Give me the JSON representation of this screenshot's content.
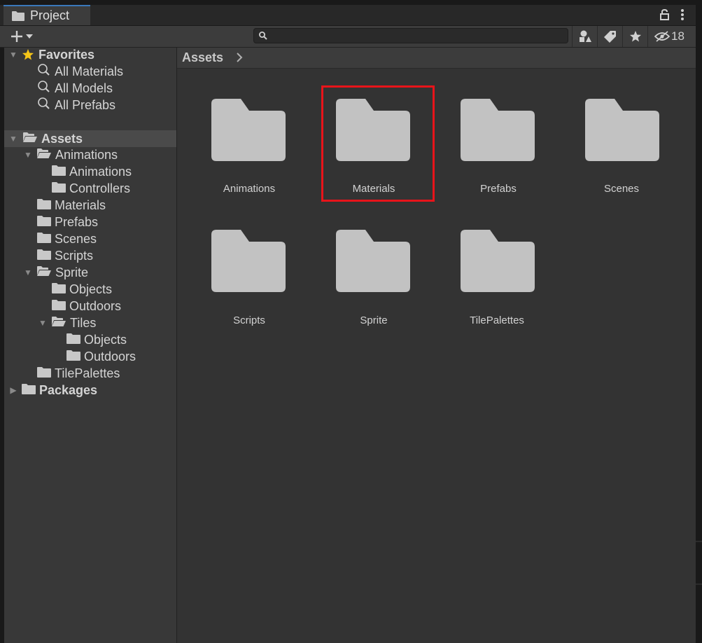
{
  "window": {
    "tab_label": "Project",
    "hidden_count": "18",
    "search": {
      "value": "",
      "placeholder": ""
    }
  },
  "breadcrumb": {
    "label": "Assets"
  },
  "tree": {
    "favorites": {
      "label": "Favorites",
      "items": [
        "All Materials",
        "All Models",
        "All Prefabs"
      ]
    },
    "assets": {
      "label": "Assets",
      "animations": {
        "label": "Animations",
        "children": [
          "Animations",
          "Controllers"
        ]
      },
      "materials": "Materials",
      "prefabs": "Prefabs",
      "scenes": "Scenes",
      "scripts": "Scripts",
      "sprite": {
        "label": "Sprite",
        "objects": "Objects",
        "outdoors": "Outdoors",
        "tiles": {
          "label": "Tiles",
          "children": [
            "Objects",
            "Outdoors"
          ]
        }
      },
      "tilepalettes": "TilePalettes"
    },
    "packages": {
      "label": "Packages"
    }
  },
  "grid": {
    "folders": [
      "Animations",
      "Materials",
      "Prefabs",
      "Scenes",
      "Scripts",
      "Sprite",
      "TilePalettes"
    ],
    "highlighted": "Materials"
  },
  "icons": {
    "tab": "folder-icon",
    "add": "plus-icon",
    "dropdown": "chevron-down-icon",
    "lock": "lock-icon",
    "menu": "kebab-menu-icon",
    "search": "search-icon",
    "type_filter": "shapes-filter-icon",
    "label_filter": "tag-icon",
    "favorites_filter": "star-icon",
    "hidden_packages": "eye-slash-icon"
  },
  "colors": {
    "highlight": "#e8141a",
    "tab_accent": "#3a79bb",
    "star": "#f5c518",
    "folder": "#c2c2c2"
  }
}
